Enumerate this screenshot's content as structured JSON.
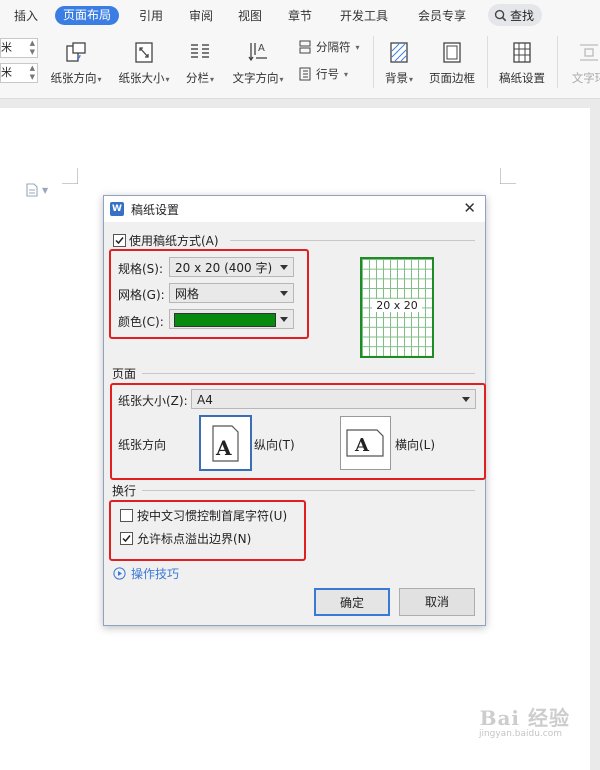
{
  "ribbon": {
    "tabs": [
      {
        "label": "插入"
      },
      {
        "label": "页面布局",
        "active": true
      },
      {
        "label": "引用"
      },
      {
        "label": "审阅"
      },
      {
        "label": "视图"
      },
      {
        "label": "章节"
      },
      {
        "label": "开发工具"
      },
      {
        "label": "会员专享"
      }
    ],
    "search_label": "查找",
    "accent_color": "#3b7ee3"
  },
  "toolbar": {
    "spinner_unit_1": "米",
    "spinner_unit_2": "米",
    "orientation_label": "纸张方向",
    "size_label": "纸张大小",
    "columns_label": "分栏",
    "text_direction_label": "文字方向",
    "separator_label": "分隔符",
    "line_number_label": "行号",
    "background_label": "背景",
    "page_border_label": "页面边框",
    "manuscript_label": "稿纸设置",
    "text_wrap_label": "文字环"
  },
  "dialog": {
    "title": "稿纸设置",
    "use_manuscript": {
      "label": "使用稿纸方式(A)",
      "checked": true
    },
    "spec": {
      "label": "规格(S):",
      "value": "20 x 20 (400 字)"
    },
    "grid": {
      "label": "网格(G):",
      "value": "网格"
    },
    "color": {
      "label": "颜色(C):",
      "value_color": "#078a0e"
    },
    "preview_label": "20 x 20",
    "page_section": "页面",
    "paper_size": {
      "label": "纸张大小(Z):",
      "value": "A4"
    },
    "orientation": {
      "label": "纸张方向",
      "portrait": "纵向(T)",
      "landscape": "横向(L)",
      "selected": "portrait"
    },
    "wrap_section": "换行",
    "control_chars": {
      "label": "按中文习惯控制首尾字符(U)",
      "checked": false
    },
    "allow_overflow": {
      "label": "允许标点溢出边界(N)",
      "checked": true
    },
    "tips_label": "操作技巧",
    "ok_label": "确定",
    "cancel_label": "取消"
  },
  "watermark": {
    "text": "Bai 经验",
    "url": "jingyan.baidu.com"
  }
}
